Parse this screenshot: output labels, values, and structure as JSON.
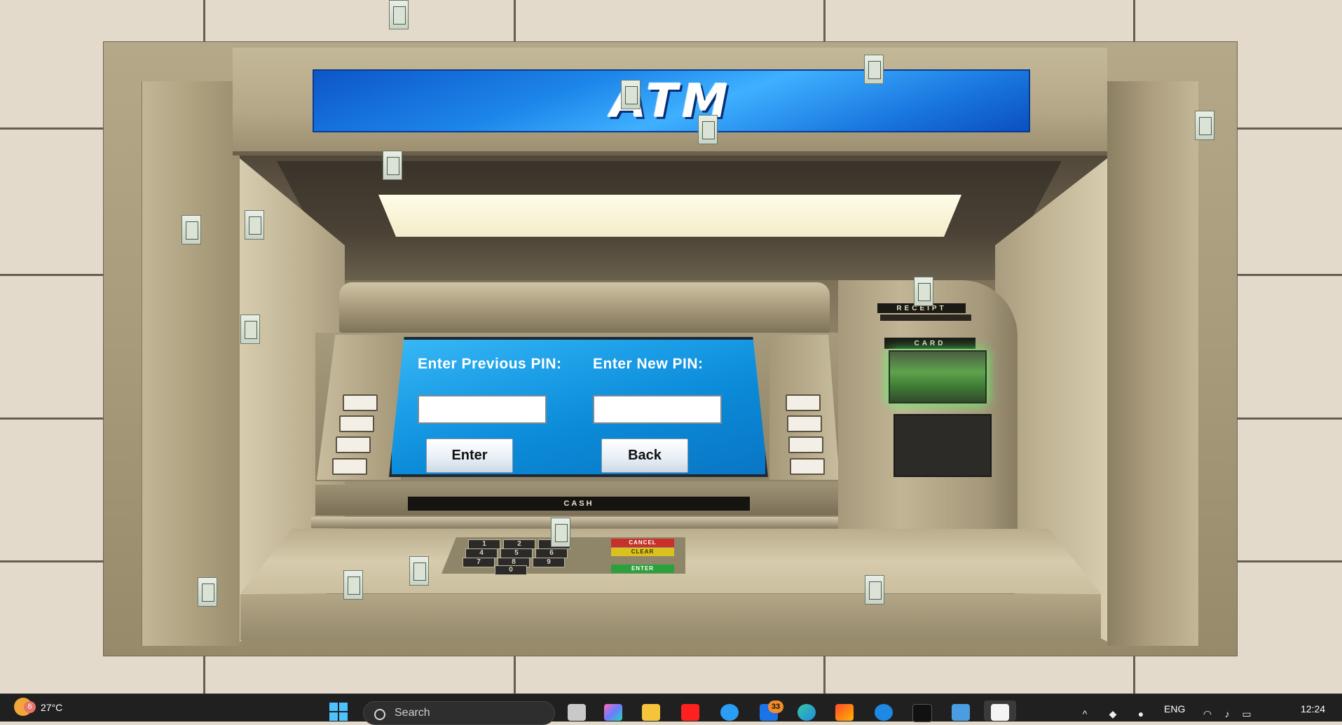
{
  "atm": {
    "banner_text": "ATM",
    "labels": {
      "previous_pin": "Enter Previous PIN:",
      "new_pin": "Enter New PIN:"
    },
    "fields": {
      "previous_pin_value": "",
      "new_pin_value": ""
    },
    "buttons": {
      "enter": "Enter",
      "back": "Back"
    },
    "slots": {
      "receipt": "RECEIPT",
      "card": "CARD",
      "cash": "CASH"
    },
    "keypad": {
      "keys": [
        "1",
        "2",
        "3",
        "4",
        "5",
        "6",
        "7",
        "8",
        "9",
        "0"
      ],
      "cancel": "CANCEL",
      "clear": "CLEAR",
      "enter": "ENTER"
    }
  },
  "taskbar": {
    "weather_badge": "6",
    "temperature": "27°C",
    "search_placeholder": "Search",
    "mail_badge": "33",
    "language": "ENG",
    "time": "12:24",
    "apps": [
      "task-view",
      "copilot",
      "file-explorer",
      "youtube",
      "weather-app",
      "mail",
      "edge",
      "office",
      "browser",
      "terminal",
      "notepad",
      "java"
    ]
  },
  "colors": {
    "banner": "#1d86ea",
    "screen": "#1a9ce6",
    "card_reader_glow": "#55ff66",
    "taskbar": "#202020"
  }
}
